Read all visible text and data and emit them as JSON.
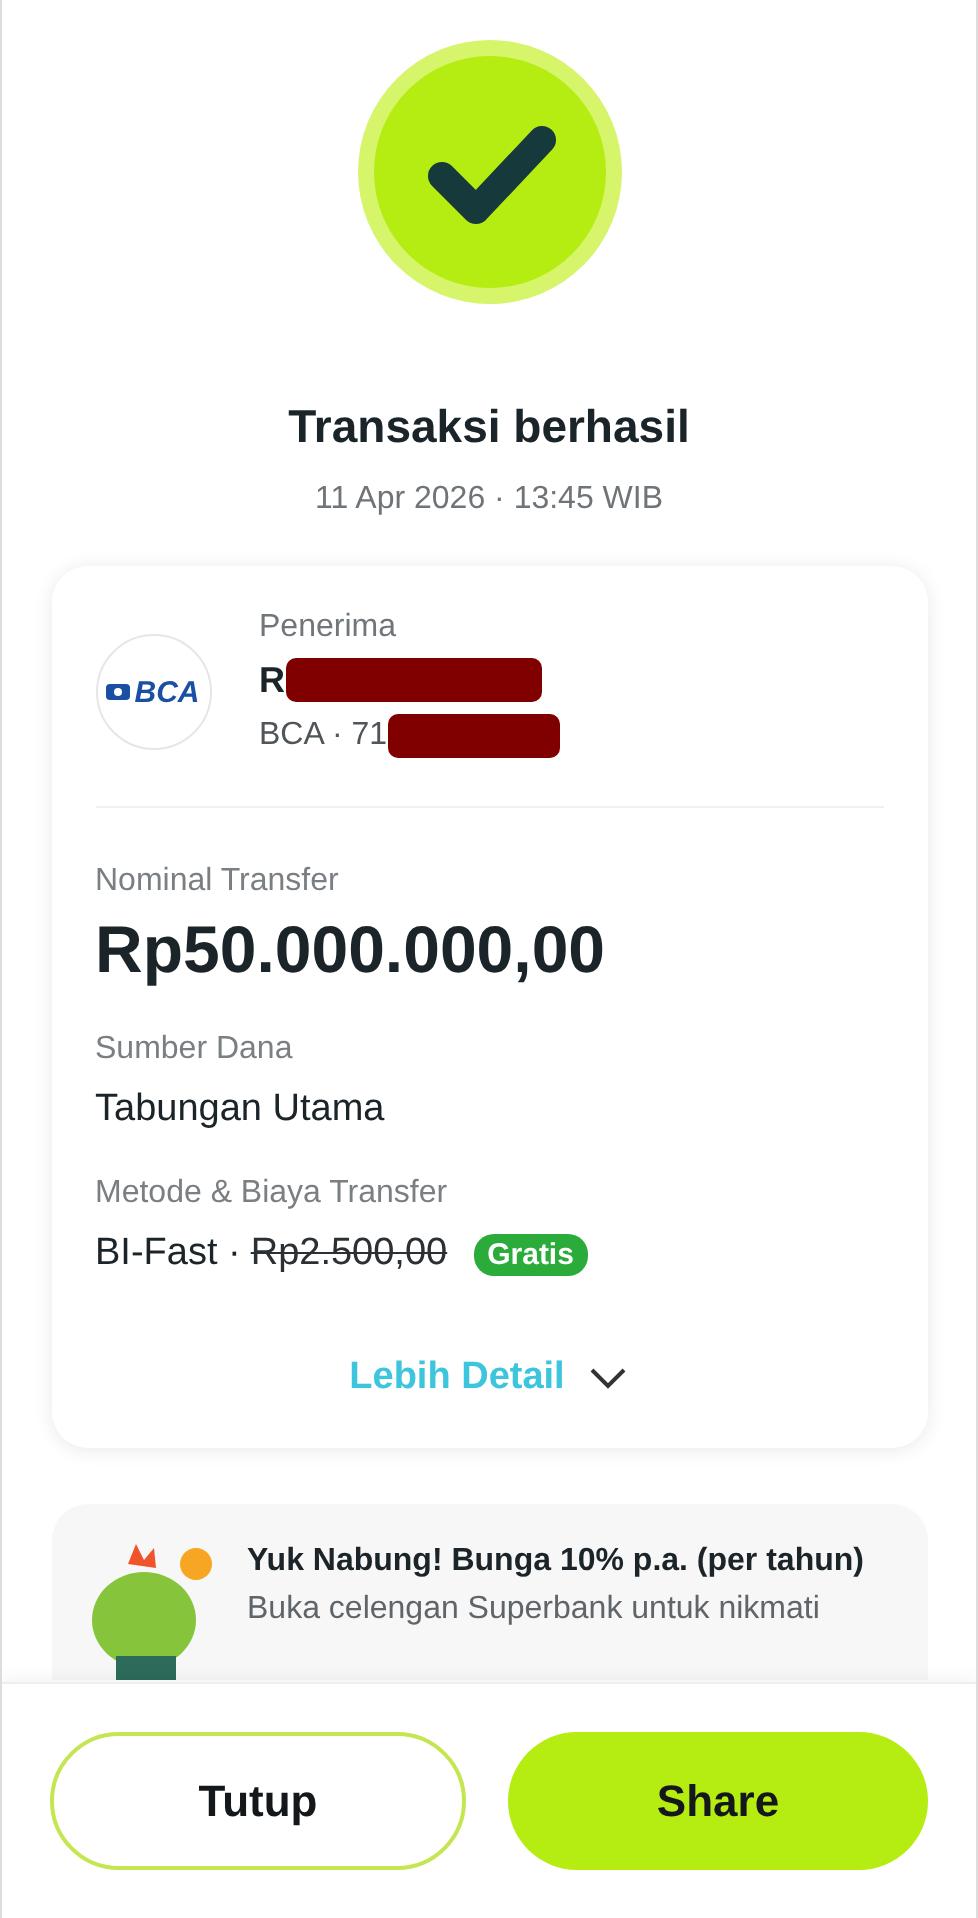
{
  "status": {
    "title": "Transaksi berhasil",
    "timestamp": "11 Apr 2026 · 13:45 WIB"
  },
  "recipient": {
    "label": "Penerima",
    "bank_logo": "BCA",
    "name": "R",
    "account": "BCA · 71",
    "redacted": true
  },
  "details": [
    {
      "kind": "amount",
      "label": "Nominal Transfer",
      "value": "Rp50.000.000,00"
    },
    {
      "kind": "plain",
      "label": "Sumber Dana",
      "value": "Tabungan Utama"
    },
    {
      "kind": "fee",
      "label": "Metode & Biaya Transfer",
      "value": "BI-Fast ·",
      "original_fee": "Rp2.500,00",
      "badge": "Gratis"
    }
  ],
  "more_link": "Lebih Detail",
  "promo": {
    "title": "Yuk Nabung! Bunga 10% p.a. (per tahun)",
    "text": "Buka celengan Superbank untuk nikmati"
  },
  "buttons": [
    {
      "kind": "secondary",
      "label": "Tutup"
    },
    {
      "kind": "primary",
      "label": "Share"
    }
  ]
}
